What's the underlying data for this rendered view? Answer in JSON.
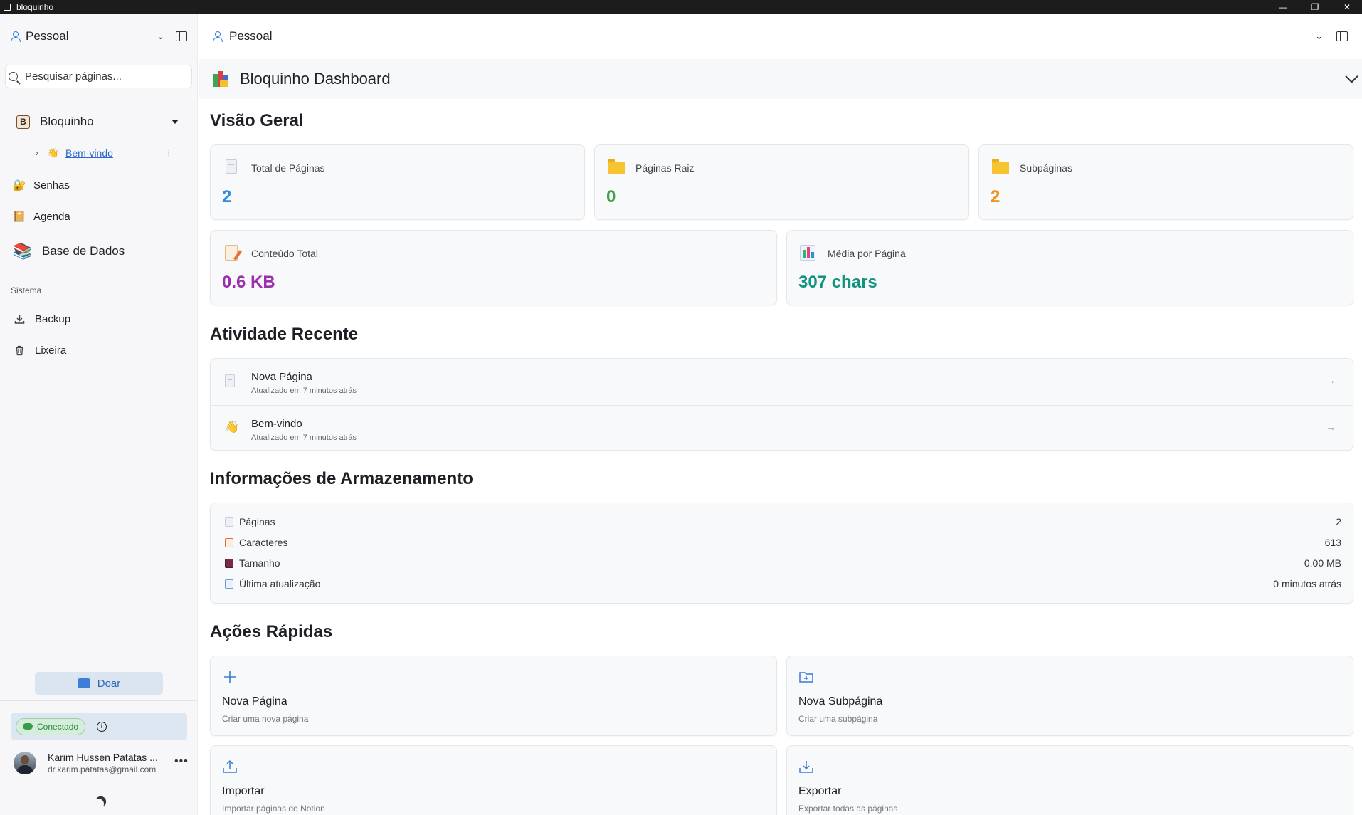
{
  "window": {
    "title": "bloquinho",
    "controls": [
      "—",
      "❐",
      "✕"
    ]
  },
  "sidebar": {
    "workspace": "Pessoal",
    "search_placeholder": "Pesquisar páginas...",
    "tree": {
      "root_label": "Bloquinho",
      "root_icon_letter": "B",
      "child_label": "Bem-vindo",
      "child_emoji": "👋"
    },
    "items": [
      {
        "label": "Senhas",
        "emoji": "🔐"
      },
      {
        "label": "Agenda",
        "emoji": "📔"
      },
      {
        "label": "Base de Dados",
        "emoji": "📚"
      }
    ],
    "section_title": "Sistema",
    "system_items": [
      {
        "label": "Backup",
        "icon": "download-icon"
      },
      {
        "label": "Lixeira",
        "icon": "trash-icon"
      }
    ],
    "donate_label": "Doar",
    "connection_status": "Conectado",
    "user": {
      "name": "Karim Hussen Patatas ...",
      "email": "dr.karim.patatas@gmail.com"
    }
  },
  "topbar": {
    "workspace": "Pessoal"
  },
  "dashboard": {
    "title": "Bloquinho Dashboard",
    "overview": {
      "heading": "Visão Geral",
      "stats": [
        {
          "label": "Total de Páginas",
          "value": "2",
          "color": "#2b8ee0"
        },
        {
          "label": "Páginas Raiz",
          "value": "0",
          "color": "#3fa14c"
        },
        {
          "label": "Subpáginas",
          "value": "2",
          "color": "#f0901b"
        },
        {
          "label": "Conteúdo Total",
          "value": "0.6 KB",
          "color": "#9b2fae"
        },
        {
          "label": "Média por Página",
          "value": "307 chars",
          "color": "#12937f"
        }
      ]
    },
    "recent": {
      "heading": "Atividade Recente",
      "items": [
        {
          "title": "Nova Página",
          "subtitle": "Atualizado em 7 minutos atrás",
          "icon": "📄"
        },
        {
          "title": "Bem-vindo",
          "subtitle": "Atualizado em 7 minutos atrás",
          "icon": "👋"
        }
      ]
    },
    "storage": {
      "heading": "Informações de Armazenamento",
      "rows": [
        {
          "label": "Páginas",
          "value": "2",
          "color": "#c9ccd8"
        },
        {
          "label": "Caracteres",
          "value": "613",
          "color": "#e2703a"
        },
        {
          "label": "Tamanho",
          "value": "0.00 MB",
          "color": "#7b2a4a"
        },
        {
          "label": "Última atualização",
          "value": "0 minutos atrás",
          "color": "#6f9bd1"
        }
      ]
    },
    "quick_actions": {
      "heading": "Ações Rápidas",
      "items": [
        {
          "title": "Nova Página",
          "subtitle": "Criar uma nova página",
          "icon": "plus-icon"
        },
        {
          "title": "Nova Subpágina",
          "subtitle": "Criar uma subpágina",
          "icon": "folder-plus-icon"
        },
        {
          "title": "Importar",
          "subtitle": "Importar páginas do Notion",
          "icon": "upload-icon"
        },
        {
          "title": "Exportar",
          "subtitle": "Exportar todas as páginas",
          "icon": "download-icon"
        }
      ]
    }
  }
}
